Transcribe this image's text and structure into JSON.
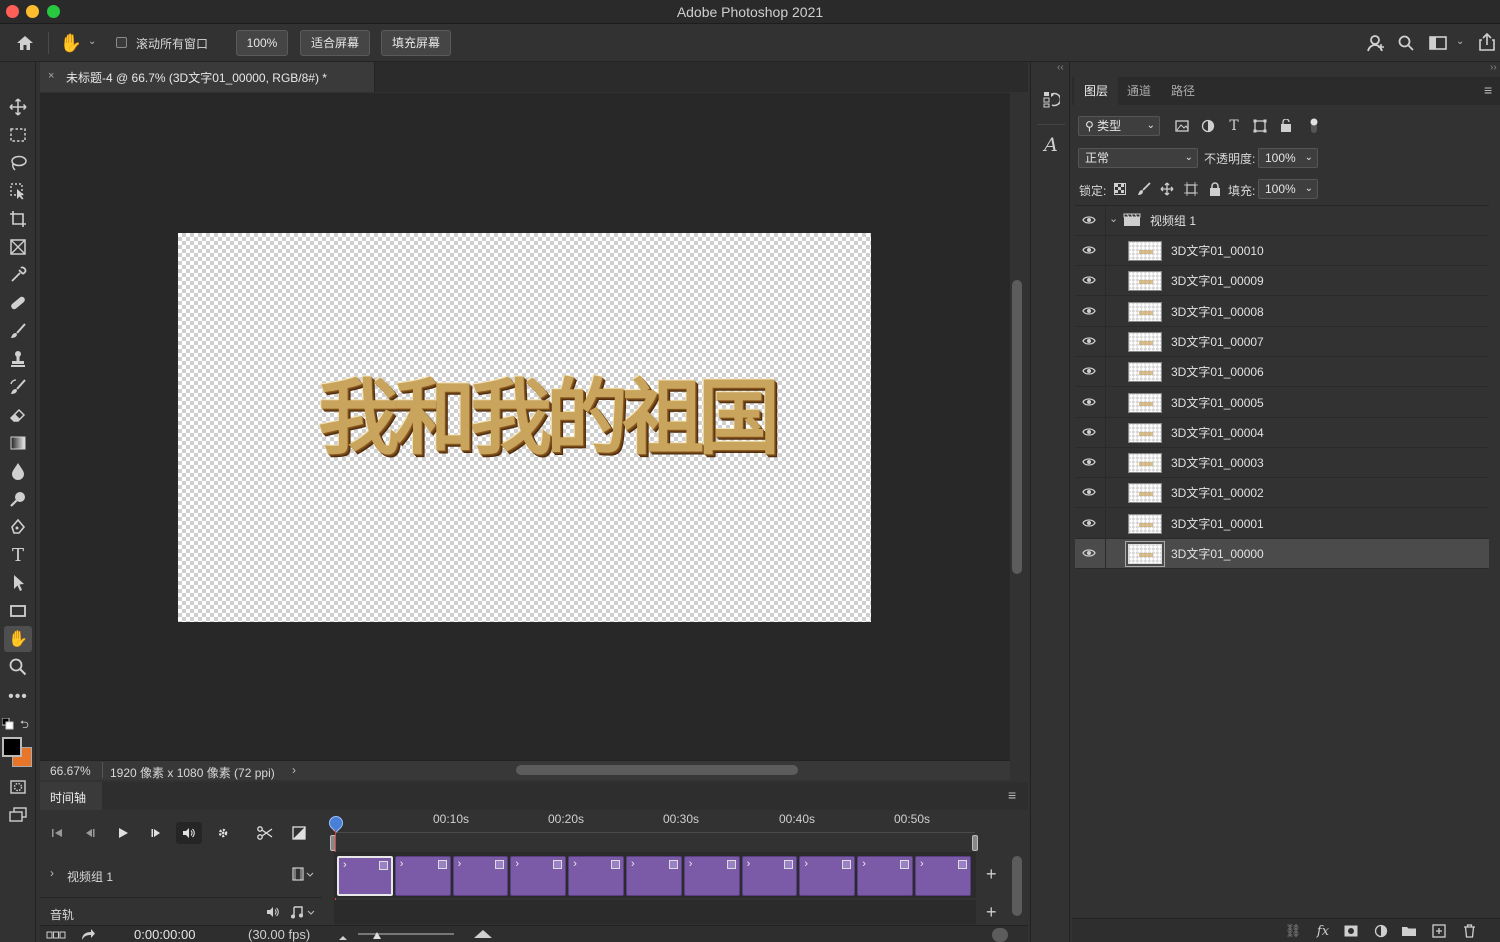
{
  "app": {
    "title": "Adobe Photoshop 2021"
  },
  "options_bar": {
    "scroll_all_windows_label": "滚动所有窗口",
    "zoom_button": "100%",
    "fit_screen_button": "适合屏幕",
    "fill_screen_button": "填充屏幕"
  },
  "document": {
    "tab_title": "未标题-4 @ 66.7% (3D文字01_00000, RGB/8#) *",
    "art_text": "我和我的祖国",
    "zoom": "66.67%",
    "info": "1920 像素 x 1080 像素 (72 ppi)"
  },
  "panels": {
    "tabs": [
      "图层",
      "通道",
      "路径"
    ],
    "filter_kind": "类型",
    "blend_mode": "正常",
    "opacity_label": "不透明度:",
    "opacity_value": "100%",
    "lock_label": "锁定:",
    "fill_label": "填充:",
    "fill_value": "100%",
    "group_name": "视频组 1",
    "layers": [
      "3D文字01_00010",
      "3D文字01_00009",
      "3D文字01_00008",
      "3D文字01_00007",
      "3D文字01_00006",
      "3D文字01_00005",
      "3D文字01_00004",
      "3D文字01_00003",
      "3D文字01_00002",
      "3D文字01_00001",
      "3D文字01_00000"
    ],
    "selected_layer": "3D文字01_00000"
  },
  "timeline": {
    "title": "时间轴",
    "ticks": [
      "00:10s",
      "00:20s",
      "00:30s",
      "00:40s",
      "00:50s"
    ],
    "video_group": "视频组 1",
    "audio_track": "音轨",
    "timecode": "0:00:00:00",
    "fps": "(30.00 fps)"
  },
  "colors": {
    "accent_purple": "#7b5aa8",
    "playhead": "#4a7fd6",
    "foreground": "#000000",
    "background_swatch": "#e8762a"
  }
}
